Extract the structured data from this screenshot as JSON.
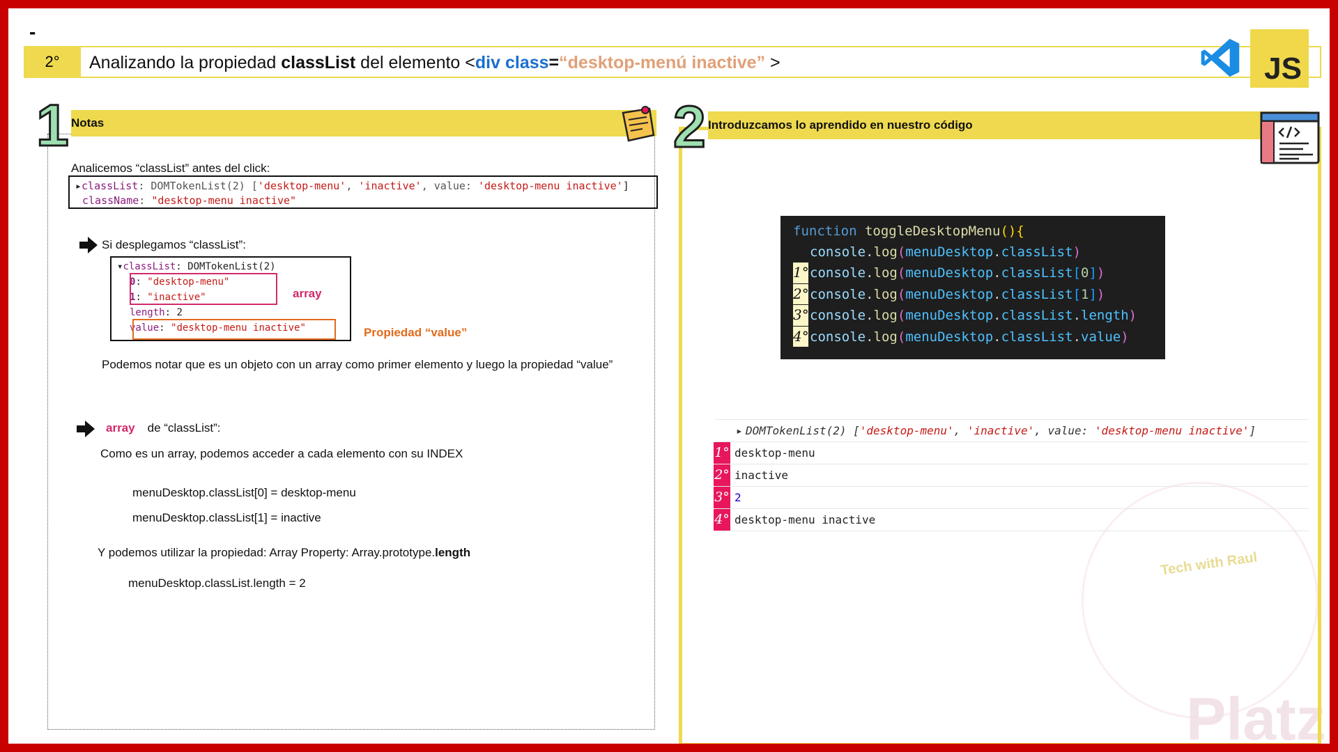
{
  "top_dash": "-",
  "header": {
    "number": "2°",
    "title_pre": "Analizando la propiedad ",
    "title_bold": "classList",
    "title_mid": " del elemento <",
    "title_div": "div",
    "title_class": "class",
    "title_eq": "=",
    "title_value": "“desktop-menú inactive”",
    "title_end": " >"
  },
  "badges": {
    "vscode_icon": "vscode-icon",
    "js_label": "JS"
  },
  "left": {
    "number": "1",
    "bar_title": "Notas",
    "intro": "Analicemos “classList” antes del click:",
    "code1_line1": {
      "key": "classList",
      "type": ": DOMTokenList(2) [",
      "s1": "'desktop-menu'",
      "comma": ", ",
      "s2": "'inactive'",
      "value_key": ", value: ",
      "s3": "'desktop-menu inactive'",
      "close": "]"
    },
    "code1_line2": {
      "key": "className",
      "colon": ": ",
      "value": "\"desktop-menu inactive\""
    },
    "expand_label": "Si desplegamos “classList”:",
    "code2": {
      "head_key": "classList",
      "head_rest": ": DOMTokenList(2)",
      "i0": "0",
      "v0": "\"desktop-menu\"",
      "i1": "1",
      "v1": "\"inactive\"",
      "len_key": "length",
      "len_val": "2",
      "val_key": "value",
      "val_val": "\"desktop-menu inactive\""
    },
    "array_tag": "array",
    "prop_tag": "Propiedad “value”",
    "note": "Podemos notar que es un objeto con un array como primer elemento y luego la propiedad “value”",
    "array_head_pink": "array",
    "array_head_rest": "de “classList”:",
    "index_note": "Como es un array, podemos acceder a cada elemento con su INDEX",
    "ex0": "menuDesktop.classList[0] = desktop-menu",
    "ex1": "menuDesktop.classList[1] = inactive",
    "prop_note_pre": "Y podemos utilizar la propiedad: Array Property:  Array.prototype.",
    "prop_note_bold": "length",
    "len_example": "menuDesktop.classList.length = 2"
  },
  "right": {
    "number": "2",
    "bar_title": "Introduzcamos lo aprendido en nuestro código",
    "code": {
      "kw": "function",
      "fn": "toggleDesktopMenu",
      "paren": "()",
      "brace": "{",
      "console": "console",
      "log": "log",
      "obj": "menuDesktop",
      "prop": "classList",
      "idx0": "0",
      "idx1": "1",
      "length": "length",
      "value": "value",
      "ticks": [
        "1°",
        "2°",
        "3°",
        "4°"
      ]
    },
    "console_head": {
      "type": "DOMTokenList(2) [",
      "s1": "'desktop-menu'",
      "s2": "'inactive'",
      "vk": ", value: ",
      "s3": "'desktop-menu inactive'",
      "close": "]"
    },
    "console_rows": [
      {
        "n": "1°",
        "text": "desktop-menu"
      },
      {
        "n": "2°",
        "text": "inactive"
      },
      {
        "n": "3°",
        "text": "2"
      },
      {
        "n": "4°",
        "text": "desktop-menu inactive"
      }
    ]
  },
  "watermark": {
    "brand": "Platzi",
    "credit": "Tech with Raul"
  },
  "colors": {
    "frame": "#c90000",
    "yellow": "#efd94e",
    "pink": "#e8165c",
    "orange": "#e26a1c",
    "mint": "#9ee0b0"
  }
}
